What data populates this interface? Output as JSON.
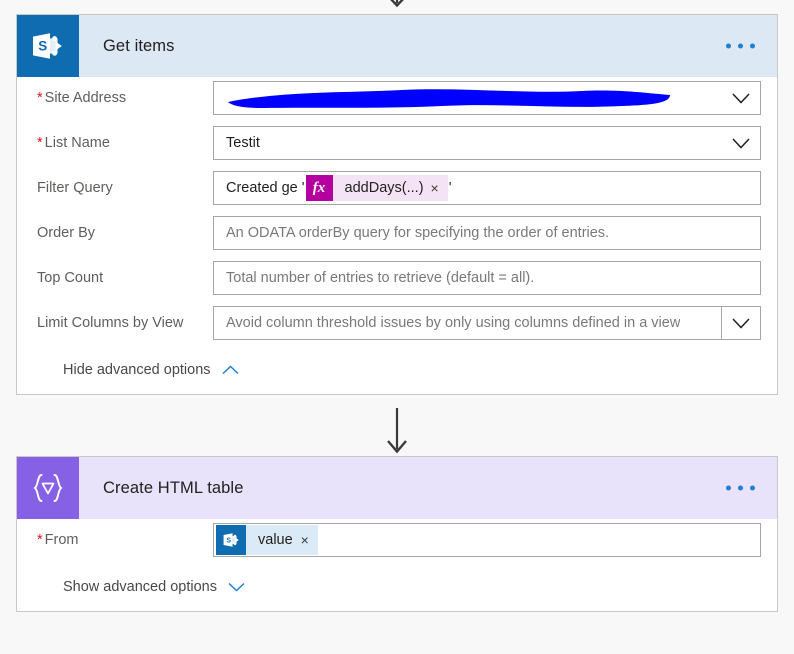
{
  "connectors": {
    "top_arrow": "arrow-down",
    "middle_arrow": "arrow-down"
  },
  "colors": {
    "sharepoint_blue": "#0f6cb0",
    "sharepoint_header": "#dce8f3",
    "dataop_purple": "#8661e5",
    "dataop_header": "#e9e2fb",
    "expression_magenta": "#b4009e",
    "required_red": "#e81123",
    "link_blue": "#1f7fd1",
    "redaction_blue": "#0000ff"
  },
  "cards": [
    {
      "id": "get-items",
      "title": "Get items",
      "icon": "sharepoint-icon",
      "menu": "more-options-icon",
      "fields": [
        {
          "label": "Site Address",
          "required": true,
          "type": "dropdown-redacted",
          "value": "",
          "redacted": true,
          "chevron": "chevron-down-icon"
        },
        {
          "label": "List Name",
          "required": true,
          "type": "dropdown",
          "value": "Testit",
          "chevron": "chevron-down-icon"
        },
        {
          "label": "Filter Query",
          "required": false,
          "type": "expression",
          "prefix": "Created ge '",
          "token_badge": "fx",
          "token_label": "addDays(...)",
          "token_remove": "×",
          "suffix": "'"
        },
        {
          "label": "Order By",
          "required": false,
          "type": "text",
          "value": "",
          "placeholder": "An ODATA orderBy query for specifying the order of entries."
        },
        {
          "label": "Top Count",
          "required": false,
          "type": "text",
          "value": "",
          "placeholder": "Total number of entries to retrieve (default = all)."
        },
        {
          "label": "Limit Columns by View",
          "required": false,
          "type": "dropdown-bordered",
          "value": "",
          "placeholder": "Avoid column threshold issues by only using columns defined in a view",
          "chevron": "chevron-down-icon"
        }
      ],
      "advanced_toggle": {
        "label": "Hide advanced options",
        "icon": "chevron-up-icon",
        "state": "expanded"
      }
    },
    {
      "id": "create-html-table",
      "title": "Create HTML table",
      "icon": "data-operation-icon",
      "menu": "more-options-icon",
      "fields": [
        {
          "label": "From",
          "required": true,
          "type": "dynamic-token",
          "token_icon": "sharepoint-icon",
          "token_label": "value",
          "token_remove": "×"
        }
      ],
      "advanced_toggle": {
        "label": "Show advanced options",
        "icon": "chevron-down-icon",
        "state": "collapsed"
      }
    }
  ]
}
